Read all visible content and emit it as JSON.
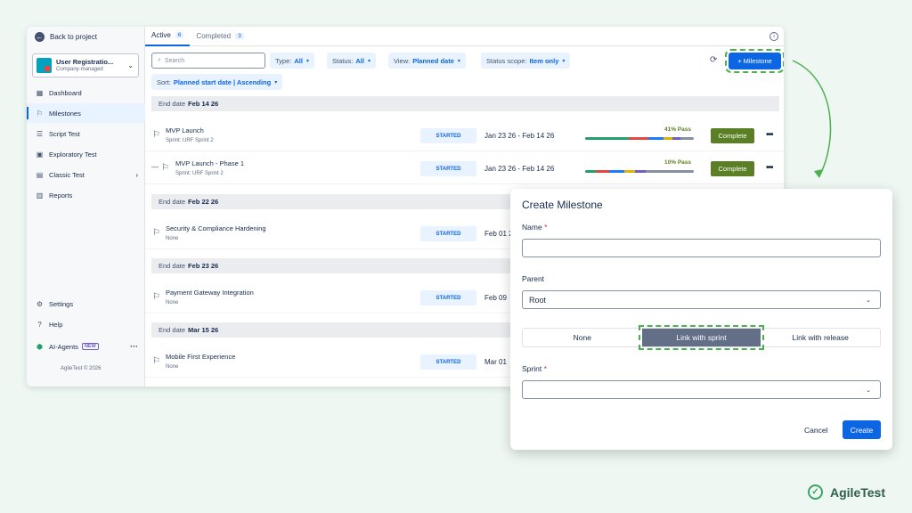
{
  "sidebar": {
    "back": "Back to project",
    "project_name": "User Registratio...",
    "project_type": "Company-managed",
    "items": [
      {
        "label": "Dashboard",
        "icon": "dashboard-icon"
      },
      {
        "label": "Milestones",
        "icon": "flag-icon"
      },
      {
        "label": "Script Test",
        "icon": "script-icon"
      },
      {
        "label": "Exploratory Test",
        "icon": "exploratory-icon"
      },
      {
        "label": "Classic Test",
        "icon": "table-icon"
      },
      {
        "label": "Reports",
        "icon": "chart-icon"
      }
    ],
    "bottom": [
      {
        "label": "Settings",
        "icon": "gear-icon"
      },
      {
        "label": "Help",
        "icon": "help-icon"
      },
      {
        "label": "AI-Agents",
        "icon": "ai-icon",
        "badge": "NEW"
      }
    ],
    "copyright": "AgileTest © 2026"
  },
  "tabs": [
    {
      "label": "Active",
      "count": "6"
    },
    {
      "label": "Completed",
      "count": "3"
    }
  ],
  "toolbar": {
    "search_placeholder": "Search",
    "filters": [
      {
        "label": "Type:",
        "value": "All"
      },
      {
        "label": "Status:",
        "value": "All"
      },
      {
        "label": "View:",
        "value": "Planned date"
      },
      {
        "label": "Status scope:",
        "value": "Item only"
      }
    ],
    "sort_label": "Sort:",
    "sort_value": "Planned start date | Ascending",
    "milestone_button": "+ Milestone"
  },
  "groups": [
    {
      "label": "End date",
      "date": "Feb 14 26"
    },
    {
      "label": "End date",
      "date": "Feb 22 26"
    },
    {
      "label": "End date",
      "date": "Feb 23 26"
    },
    {
      "label": "End date",
      "date": "Mar 15 26"
    }
  ],
  "rows": [
    {
      "name": "MVP Launch",
      "sub": "Sprint: URF Sprint 2",
      "status": "STARTED",
      "dates": "Jan 23 26 - Feb 14 26",
      "pct": "41% Pass",
      "complete": "Complete"
    },
    {
      "name": "MVP Launch - Phase 1",
      "sub": "Sprint: URF Sprint 2",
      "status": "STARTED",
      "dates": "Jan 23 26 - Feb 14 26",
      "pct": "10% Pass",
      "complete": "Complete"
    },
    {
      "name": "Security & Compliance Hardening",
      "sub": "None",
      "status": "STARTED",
      "dates": "Feb 01 2"
    },
    {
      "name": "Payment Gateway Integration",
      "sub": "None",
      "status": "STARTED",
      "dates": "Feb 09"
    },
    {
      "name": "Mobile First Experience",
      "sub": "None",
      "status": "STARTED",
      "dates": "Mar 01"
    }
  ],
  "modal": {
    "title": "Create Milestone",
    "name_label": "Name",
    "name_value": "",
    "parent_label": "Parent",
    "parent_value": "Root",
    "link_options": [
      "None",
      "Link with sprint",
      "Link with release"
    ],
    "link_selected": "Link with sprint",
    "sprint_label": "Sprint",
    "sprint_value": "",
    "required_mark": "*",
    "cancel": "Cancel",
    "create": "Create"
  },
  "brand": "AgileTest",
  "colors": {
    "accent": "#0c66e4",
    "complete": "#5b7f24",
    "highlight": "#4caf50"
  }
}
